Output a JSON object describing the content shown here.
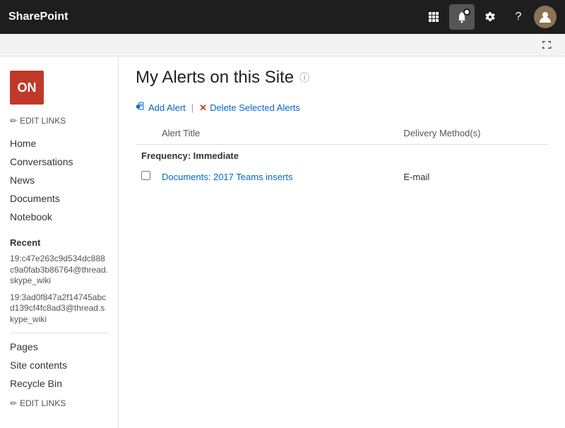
{
  "topbar": {
    "logo": "SharePoint",
    "icons": {
      "grid": "⊞",
      "bell": "🔔",
      "settings": "⚙",
      "help": "?",
      "avatar_initials": ""
    }
  },
  "subbar": {
    "expand_icon": "⤢"
  },
  "site": {
    "logo_text": "ON",
    "edit_links_top": "EDIT LINKS",
    "page_title": "My Alerts on this Site",
    "info_icon": "ⓘ"
  },
  "nav": {
    "items": [
      {
        "label": "Home"
      },
      {
        "label": "Conversations"
      },
      {
        "label": "News"
      },
      {
        "label": "Documents"
      },
      {
        "label": "Notebook"
      }
    ],
    "recent_label": "Recent",
    "recent_items": [
      {
        "label": "19:c47e263c9d534dc888c9a0fab3b86764@thread.skype_wiki"
      },
      {
        "label": "19:3ad0f847a2f14745abcd139cf4fc8ad3@thread.skype_wiki"
      }
    ],
    "bottom_items": [
      {
        "label": "Pages"
      },
      {
        "label": "Site contents"
      },
      {
        "label": "Recycle Bin"
      }
    ],
    "edit_links_bottom": "EDIT LINKS"
  },
  "toolbar": {
    "add_alert_icon": "📋",
    "add_alert_label": "Add Alert",
    "separator": "|",
    "delete_icon": "✕",
    "delete_label": "Delete Selected Alerts"
  },
  "table": {
    "column_alert_title": "Alert Title",
    "column_delivery": "Delivery Method(s)",
    "frequency_label": "Frequency: Immediate",
    "rows": [
      {
        "title": "Documents: 2017 Teams inserts",
        "delivery": "E-mail"
      }
    ]
  }
}
